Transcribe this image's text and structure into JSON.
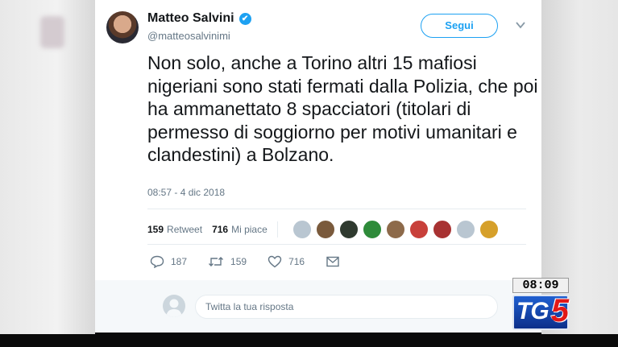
{
  "tweet": {
    "author_name": "Matteo Salvini",
    "verified_badge": "✔",
    "handle": "@matteosalvinimi",
    "follow_label": "Segui",
    "text": "Non solo, anche a Torino altri 15 mafiosi nigeriani sono stati fermati dalla Polizia, che poi ha ammanettato 8 spacciatori (titolari di permesso di soggiorno per motivi umanitari e clandestini) a Bolzano.",
    "timestamp": "08:57 - 4 dic 2018",
    "retweets_count": "159",
    "retweets_label": "Retweet",
    "likes_count": "716",
    "likes_label": "Mi piace",
    "liker_avatar_colors": [
      "#b9c6d1",
      "#7a5a3c",
      "#2f3a2f",
      "#2e8b3a",
      "#8d6a4a",
      "#c8403a",
      "#a83232",
      "#b9c6d1",
      "#d6a02a"
    ]
  },
  "actions": {
    "reply_count": "187",
    "retweet_count": "159",
    "like_count": "716"
  },
  "reply": {
    "placeholder": "Twitta la tua risposta"
  },
  "overlay": {
    "clock": "08:09",
    "channel_logo": "TG",
    "channel_logo_num": "5"
  },
  "colors": {
    "accent": "#1da1f2",
    "text": "#14171a",
    "muted": "#657786"
  }
}
